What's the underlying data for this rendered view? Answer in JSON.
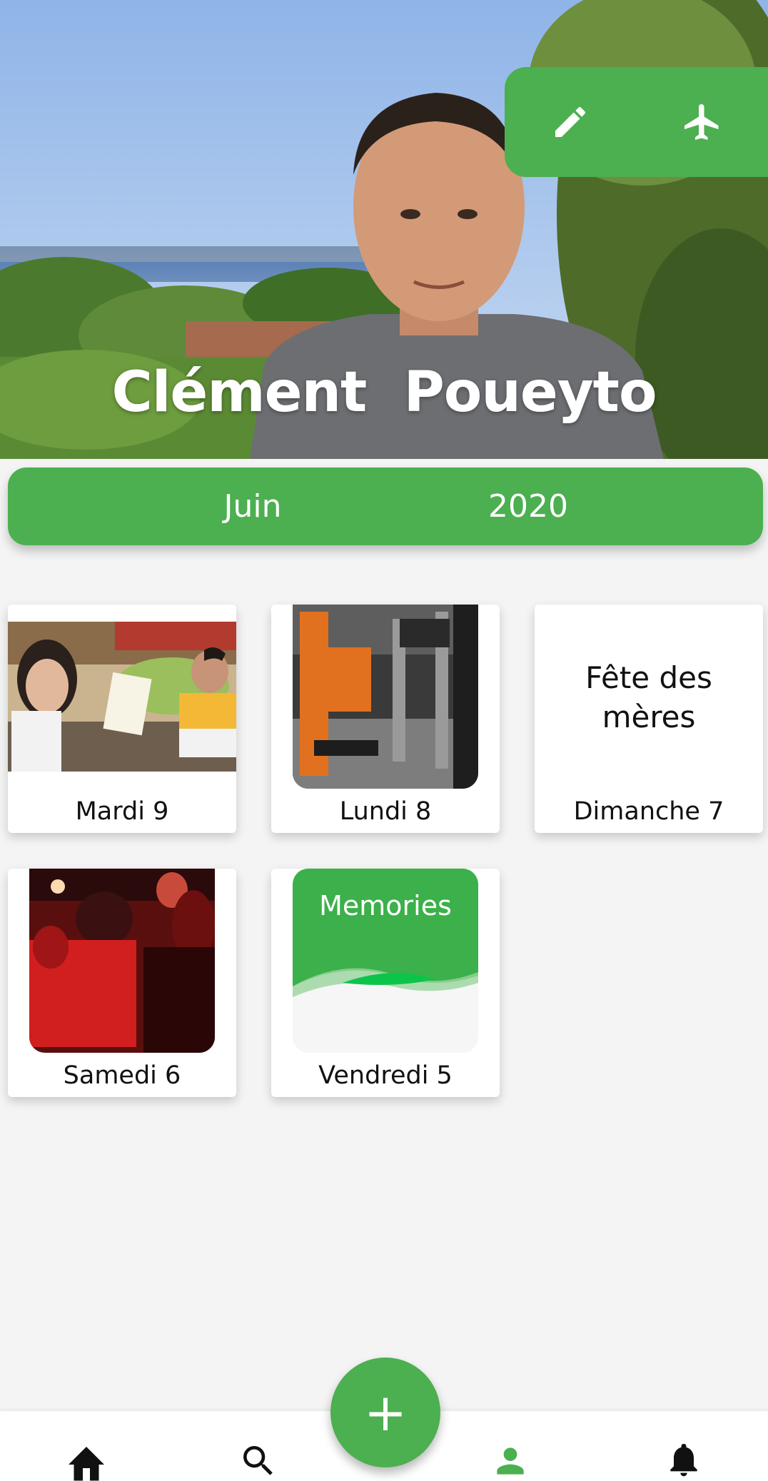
{
  "profile": {
    "name": "Clément  Poueyto"
  },
  "header_actions": {
    "edit_icon": "pencil-icon",
    "travel_icon": "airplane-icon"
  },
  "period": {
    "month": "Juin",
    "year": "2020"
  },
  "days": [
    {
      "label": "Mardi 9",
      "type": "photo"
    },
    {
      "label": "Lundi 8",
      "type": "photo"
    },
    {
      "label": "Dimanche 7",
      "type": "event",
      "event_line1": "Fête des",
      "event_line2": "mères"
    },
    {
      "label": "Samedi 6",
      "type": "photo"
    },
    {
      "label": "Vendredi 5",
      "type": "memories",
      "memories_title": "Memories"
    }
  ],
  "nav": {
    "items": [
      "home-icon",
      "search-icon",
      "add-icon",
      "profile-icon",
      "bell-icon"
    ],
    "active": "profile-icon",
    "fab_symbol": "+"
  },
  "colors": {
    "accent": "#4caf50",
    "background": "#f4f4f4",
    "nav_active": "#4caf50",
    "nav_inactive": "#111111"
  }
}
